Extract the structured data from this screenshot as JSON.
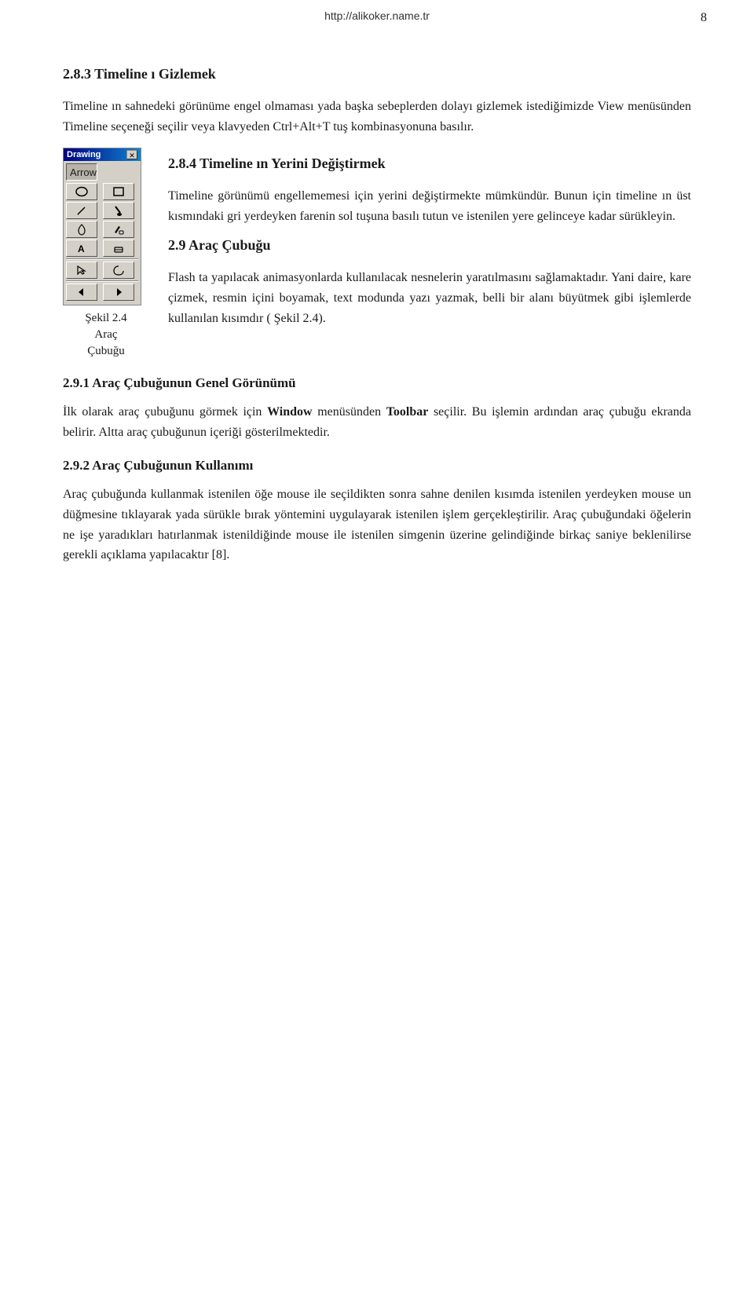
{
  "header": {
    "url": "http://alikoker.name.tr",
    "page_number": "8"
  },
  "sections": {
    "section_283": {
      "heading": "2.8.3 Timeline ı Gizlemek",
      "body1": "Timeline ın sahnedeki görünüme engel olmaması yada başka sebeplerden dolayı gizlemek istediğimizde View menüsünden Timeline seçeneği seçilir veya klavyeden Ctrl+Alt+T tuş kombinasyonuna basılır."
    },
    "section_284": {
      "heading": "2.8.4 Timeline ın Yerini Değiştirmek",
      "body1": "Timeline görünümü engellememesi için yerini değiştirmekte mümkündür. Bunun için timeline ın üst kısmındaki gri yerdeyken farenin sol tuşuna basılı tutun ve istenilen yere gelinceye kadar sürükleyin."
    },
    "section_29": {
      "heading": "2.9 Araç Çubuğu",
      "toolbar_title": "Drawing",
      "toolbar_arrow_label": "Arrow",
      "figure_label": "Şekil 2.4\nAraç\nÇubuğu",
      "body1": "Flash ta yapılacak animasyonlarda kullanılacak nesnelerin yaratılmasını sağlamaktadır. Yani daire, kare çizmek, resmin içini boyamak, text modunda yazı yazmak, belli bir alanı büyütmek gibi işlemlerde kullanılan kısımdır ( Şekil 2.4)."
    },
    "section_291": {
      "heading": "2.9.1 Araç Çubuğunun Genel Görünümü",
      "body1": "İlk olarak araç çubuğunu görmek için ",
      "bold1": "Window",
      "body1b": " menüsünden ",
      "bold2": "Toolbar",
      "body1c": " seçilir. Bu işlemin ardından araç çubuğu ekranda belirir. Altta araç çubuğunun içeriği gösterilmektedir."
    },
    "section_292": {
      "heading": "2.9.2 Araç Çubuğunun Kullanımı",
      "body1": "Araç çubuğunda kullanmak istenilen öğe mouse ile seçildikten sonra sahne denilen kısımda istenilen yerdeyken mouse un düğmesine tıklayarak yada sürükle bırak yöntemini uygulayarak istenilen işlem gerçekleştirilir. Araç çubuğundaki öğelerin ne işe yaradıkları hatırlanmak istenildiğinde mouse ile istenilen simgenin üzerine gelindiğinde birkaç saniye beklenilirse gerekli açıklama yapılacaktır [8]."
    }
  }
}
